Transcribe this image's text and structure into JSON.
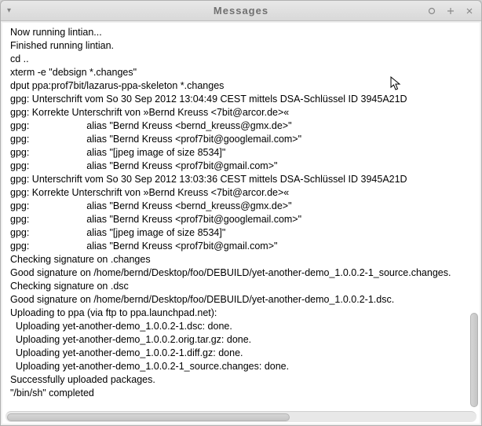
{
  "window": {
    "title": "Messages"
  },
  "lines": {
    "l0": "Now running lintian...",
    "l1": "Finished running lintian.",
    "l2": "cd ..",
    "l3": "xterm -e \"debsign *.changes\"",
    "l4": "dput ppa:prof7bit/lazarus-ppa-skeleton *.changes",
    "l5": "gpg: Unterschrift vom So 30 Sep 2012 13:04:49 CEST mittels DSA-Schlüssel ID 3945A21D",
    "l6": "gpg: Korrekte Unterschrift von »Bernd Kreuss <7bit@arcor.de>«",
    "l7": "gpg:                     alias \"Bernd Kreuss <bernd_kreuss@gmx.de>\"",
    "l8": "gpg:                     alias \"Bernd Kreuss <prof7bit@googlemail.com>\"",
    "l9": "gpg:                     alias \"[jpeg image of size 8534]\"",
    "l10": "gpg:                     alias \"Bernd Kreuss <prof7bit@gmail.com>\"",
    "l11": "gpg: Unterschrift vom So 30 Sep 2012 13:03:36 CEST mittels DSA-Schlüssel ID 3945A21D",
    "l12": "gpg: Korrekte Unterschrift von »Bernd Kreuss <7bit@arcor.de>«",
    "l13": "gpg:                     alias \"Bernd Kreuss <bernd_kreuss@gmx.de>\"",
    "l14": "gpg:                     alias \"Bernd Kreuss <prof7bit@googlemail.com>\"",
    "l15": "gpg:                     alias \"[jpeg image of size 8534]\"",
    "l16": "gpg:                     alias \"Bernd Kreuss <prof7bit@gmail.com>\"",
    "l17": "Checking signature on .changes",
    "l18": "Good signature on /home/bernd/Desktop/foo/DEBUILD/yet-another-demo_1.0.0.2-1_source.changes.",
    "l19": "Checking signature on .dsc",
    "l20": "Good signature on /home/bernd/Desktop/foo/DEBUILD/yet-another-demo_1.0.0.2-1.dsc.",
    "l21": "Uploading to ppa (via ftp to ppa.launchpad.net):",
    "l22": "  Uploading yet-another-demo_1.0.0.2-1.dsc: done.",
    "l23": "  Uploading yet-another-demo_1.0.0.2.orig.tar.gz: done.",
    "l24": "  Uploading yet-another-demo_1.0.0.2-1.diff.gz: done.",
    "l25": "  Uploading yet-another-demo_1.0.0.2-1_source.changes: done.",
    "l26": "Successfully uploaded packages.",
    "l27": "\"/bin/sh\" completed"
  }
}
